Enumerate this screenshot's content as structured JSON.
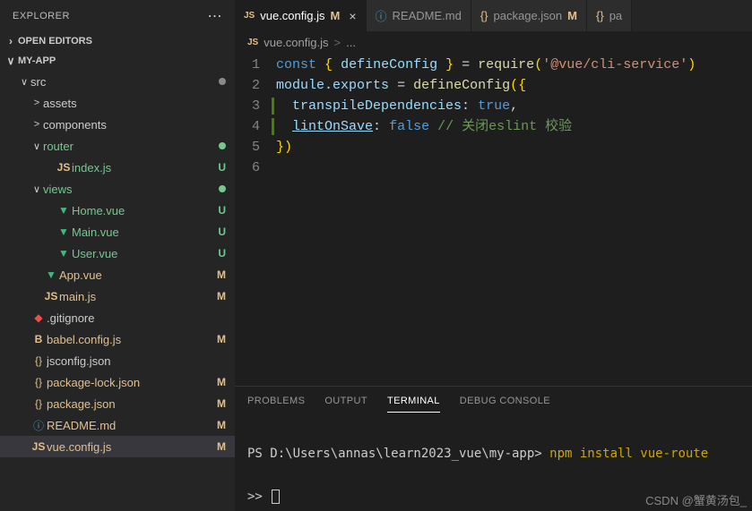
{
  "sidebar": {
    "title": "EXPLORER",
    "sections": [
      {
        "label": "OPEN EDITORS",
        "expanded": false
      },
      {
        "label": "MY-APP",
        "expanded": true
      }
    ],
    "tree": [
      {
        "indent": 1,
        "chev": "∨",
        "icon": "",
        "label": "src",
        "cls": "",
        "badge": "",
        "dot": "grey"
      },
      {
        "indent": 2,
        "chev": ">",
        "icon": "",
        "label": "assets",
        "cls": "",
        "badge": ""
      },
      {
        "indent": 2,
        "chev": ">",
        "icon": "",
        "label": "components",
        "cls": "",
        "badge": ""
      },
      {
        "indent": 2,
        "chev": "∨",
        "icon": "",
        "label": "router",
        "cls": "git-u",
        "badge": "",
        "dot": "green"
      },
      {
        "indent": 3,
        "chev": "",
        "icon": "JS",
        "iconCls": "ico-js",
        "label": "index.js",
        "cls": "git-u",
        "badge": "U"
      },
      {
        "indent": 2,
        "chev": "∨",
        "icon": "",
        "label": "views",
        "cls": "git-u",
        "badge": "",
        "dot": "green"
      },
      {
        "indent": 3,
        "chev": "",
        "icon": "▼",
        "iconCls": "ico-vue",
        "label": "Home.vue",
        "cls": "git-u",
        "badge": "U"
      },
      {
        "indent": 3,
        "chev": "",
        "icon": "▼",
        "iconCls": "ico-vue",
        "label": "Main.vue",
        "cls": "git-u",
        "badge": "U"
      },
      {
        "indent": 3,
        "chev": "",
        "icon": "▼",
        "iconCls": "ico-vue",
        "label": "User.vue",
        "cls": "git-u",
        "badge": "U"
      },
      {
        "indent": 2,
        "chev": "",
        "icon": "▼",
        "iconCls": "ico-vue",
        "label": "App.vue",
        "cls": "git-m",
        "badge": "M"
      },
      {
        "indent": 2,
        "chev": "",
        "icon": "JS",
        "iconCls": "ico-js",
        "label": "main.js",
        "cls": "git-m",
        "badge": "M"
      },
      {
        "indent": 1,
        "chev": "",
        "icon": "◆",
        "iconCls": "ico-git",
        "label": ".gitignore",
        "cls": "",
        "badge": ""
      },
      {
        "indent": 1,
        "chev": "",
        "icon": "B",
        "iconCls": "ico-js",
        "label": "babel.config.js",
        "cls": "git-m",
        "badge": "M"
      },
      {
        "indent": 1,
        "chev": "",
        "icon": "{}",
        "iconCls": "ico-brace",
        "label": "jsconfig.json",
        "cls": "",
        "badge": ""
      },
      {
        "indent": 1,
        "chev": "",
        "icon": "{}",
        "iconCls": "ico-brace",
        "label": "package-lock.json",
        "cls": "git-m",
        "badge": "M"
      },
      {
        "indent": 1,
        "chev": "",
        "icon": "{}",
        "iconCls": "ico-brace",
        "label": "package.json",
        "cls": "git-m",
        "badge": "M"
      },
      {
        "indent": 1,
        "chev": "",
        "icon": "ⓘ",
        "iconCls": "ico-info",
        "label": "README.md",
        "cls": "git-m",
        "badge": "M"
      },
      {
        "indent": 1,
        "chev": "",
        "icon": "JS",
        "iconCls": "ico-js",
        "label": "vue.config.js",
        "cls": "git-m",
        "badge": "M",
        "selected": true
      }
    ]
  },
  "tabs": [
    {
      "icon": "JS",
      "iconCls": "ico-js",
      "label": "vue.config.js",
      "git": "M",
      "active": true,
      "close": true
    },
    {
      "icon": "ⓘ",
      "iconCls": "ico-info",
      "label": "README.md",
      "git": "",
      "active": false
    },
    {
      "icon": "{}",
      "iconCls": "ico-brace",
      "label": "package.json",
      "git": "M",
      "active": false
    },
    {
      "icon": "{}",
      "iconCls": "ico-brace",
      "label": "pa",
      "git": "",
      "active": false
    }
  ],
  "breadcrumb": {
    "icon": "JS",
    "file": "vue.config.js",
    "sep": ">",
    "more": "..."
  },
  "code": {
    "lines": [
      {
        "n": "1",
        "diff": false,
        "html": "<span class='tok-kw'>const</span> <span class='tok-brace'>{</span> <span class='tok-var'>defineConfig</span> <span class='tok-brace'>}</span> <span class='tok-punc'>=</span> <span class='tok-fn'>require</span><span class='tok-brace'>(</span><span class='tok-str'>'@vue/cli-service'</span><span class='tok-brace'>)</span>"
      },
      {
        "n": "2",
        "diff": false,
        "html": "<span class='tok-var'>module</span><span class='tok-punc'>.</span><span class='tok-var'>exports</span> <span class='tok-punc'>=</span> <span class='tok-fn'>defineConfig</span><span class='tok-brace'>({</span>"
      },
      {
        "n": "3",
        "diff": true,
        "html": "  <span class='tok-var'>transpileDependencies</span><span class='tok-punc'>:</span> <span class='tok-kw'>true</span><span class='tok-punc'>,</span>"
      },
      {
        "n": "4",
        "diff": true,
        "html": "  <span class='tok-link'>lintOnSave</span><span class='tok-punc'>:</span> <span class='tok-kw'>false</span> <span class='tok-cmt'>// 关闭eslint 校验</span>"
      },
      {
        "n": "5",
        "diff": false,
        "html": "<span class='tok-brace'>})</span>"
      },
      {
        "n": "6",
        "diff": false,
        "html": ""
      }
    ]
  },
  "panel": {
    "tabs": [
      "PROBLEMS",
      "OUTPUT",
      "TERMINAL",
      "DEBUG CONSOLE"
    ],
    "active": 2,
    "terminal": {
      "line1_prefix": "PS D:\\Users\\annas\\learn2023_vue\\my-app> ",
      "line1_cmd": "npm install vue-route",
      "line2": ">> "
    }
  },
  "watermark": "CSDN @蟹黄汤包_"
}
